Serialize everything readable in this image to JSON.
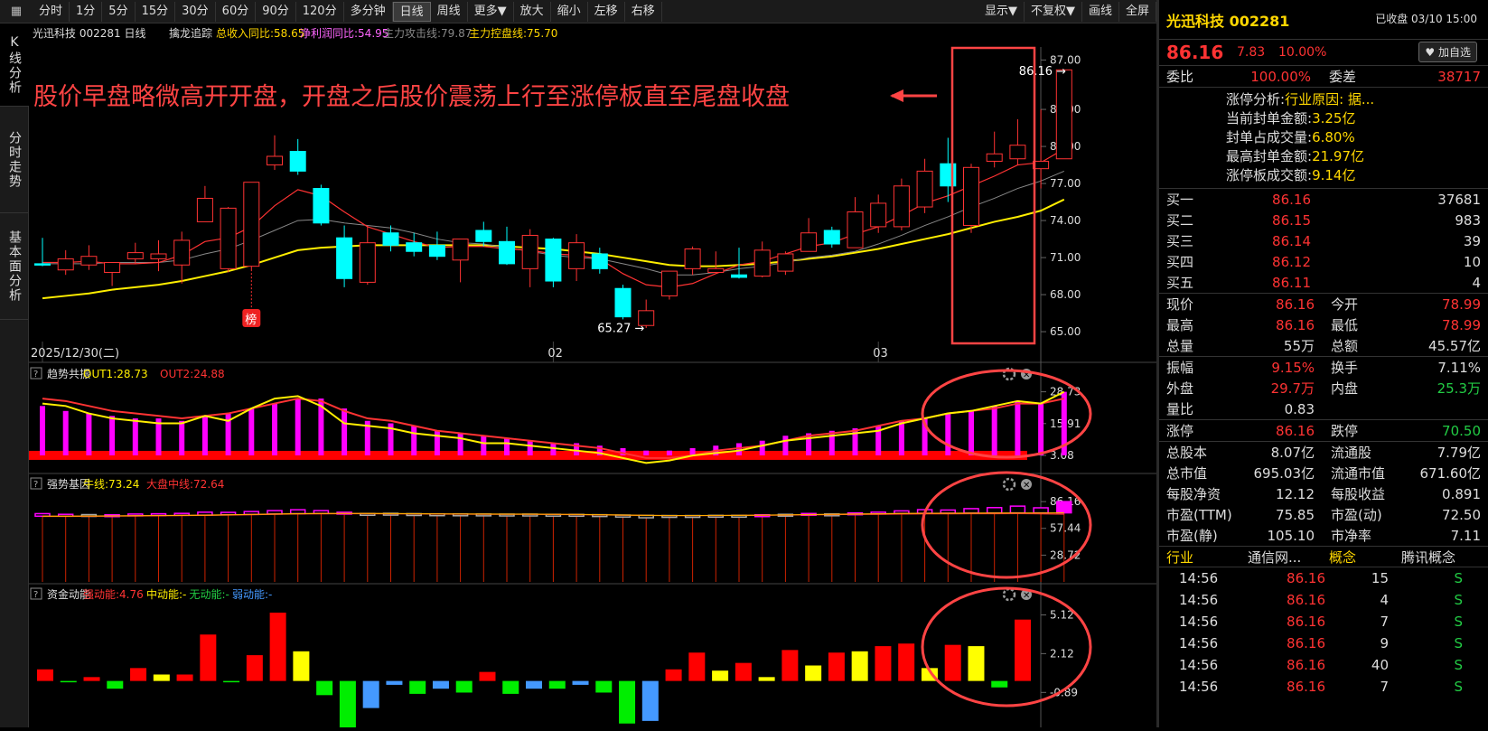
{
  "toolbar": {
    "periods": [
      "分时",
      "1分",
      "5分",
      "15分",
      "30分",
      "60分",
      "90分",
      "120分",
      "多分钟",
      "日线",
      "周线",
      "更多▼"
    ],
    "actions": [
      "放大",
      "缩小",
      "左移",
      "右移"
    ],
    "right_items": [
      "显示▼",
      "不复权▼",
      "画线",
      "全屏"
    ]
  },
  "left_tabs": [
    "K线分析",
    "分时走势",
    "基本面分析"
  ],
  "main_info": {
    "stock": "光迅科技 002281 日线",
    "indicator": "擒龙追踪",
    "rev_label": "总收入同比:58.65",
    "profit_label": "净利润同比:54.95",
    "attack_label": "主力攻击线:79.87",
    "control_label": "主力控盘线:75.70"
  },
  "annotation": "股价早盘略微高开开盘，开盘之后股价震荡上行至涨停板直至尾盘收盘",
  "chart_data": [
    {
      "type": "candlestick",
      "title": "光迅科技 002281 日线",
      "y_ticks": [
        "87.00",
        "83.00",
        "80.00",
        "77.00",
        "74.00",
        "71.00",
        "68.00",
        "65.00"
      ],
      "ylim": [
        64.2,
        88.2
      ],
      "x_labels": [
        {
          "i": 0,
          "label": "2025/12/30(二)"
        },
        {
          "i": 22,
          "label": "02"
        },
        {
          "i": 36,
          "label": "03"
        }
      ],
      "max_label": "86.16",
      "min_label": "65.27",
      "marker_label": "榜",
      "candles": [
        [
          70.5,
          70.4,
          72.6,
          70.3
        ],
        [
          70.0,
          70.9,
          71.6,
          69.6
        ],
        [
          70.4,
          71.1,
          72.0,
          70.0
        ],
        [
          69.8,
          70.6,
          70.6,
          68.7
        ],
        [
          70.9,
          71.4,
          72.2,
          70.5
        ],
        [
          70.9,
          71.3,
          72.4,
          69.9
        ],
        [
          70.4,
          72.4,
          73.1,
          68.9
        ],
        [
          73.9,
          75.8,
          76.8,
          73.9
        ],
        [
          70.1,
          75.0,
          75.1,
          69.8
        ],
        [
          70.3,
          77.1,
          77.1,
          69.9
        ],
        [
          78.5,
          79.2,
          80.9,
          78.1
        ],
        [
          79.6,
          78.0,
          80.6,
          77.7
        ],
        [
          76.6,
          73.8,
          76.9,
          73.6
        ],
        [
          72.6,
          69.3,
          73.6,
          68.6
        ],
        [
          69.0,
          72.2,
          73.6,
          68.8
        ],
        [
          73.0,
          72.0,
          73.6,
          71.5
        ],
        [
          72.2,
          71.5,
          73.0,
          71.1
        ],
        [
          72.0,
          71.1,
          73.1,
          70.8
        ],
        [
          70.8,
          72.5,
          72.5,
          69.0
        ],
        [
          73.2,
          72.3,
          73.9,
          71.9
        ],
        [
          72.3,
          70.5,
          73.5,
          70.4
        ],
        [
          70.1,
          72.8,
          73.3,
          68.6
        ],
        [
          72.5,
          69.1,
          72.6,
          68.6
        ],
        [
          70.1,
          72.2,
          72.9,
          69.1
        ],
        [
          71.3,
          70.1,
          71.8,
          69.7
        ],
        [
          68.5,
          66.2,
          68.8,
          66.0
        ],
        [
          65.5,
          66.7,
          67.6,
          65.3
        ],
        [
          67.9,
          69.9,
          69.9,
          67.6
        ],
        [
          70.1,
          71.7,
          71.9,
          69.6
        ],
        [
          69.8,
          70.1,
          71.5,
          69.8
        ],
        [
          69.6,
          69.4,
          71.8,
          69.3
        ],
        [
          69.5,
          71.6,
          72.3,
          69.4
        ],
        [
          69.9,
          71.3,
          71.5,
          69.6
        ],
        [
          71.5,
          73.0,
          74.2,
          71.5
        ],
        [
          73.2,
          72.1,
          73.5,
          71.8
        ],
        [
          71.8,
          74.7,
          75.9,
          71.8
        ],
        [
          73.5,
          75.4,
          76.1,
          73.0
        ],
        [
          73.5,
          76.8,
          77.4,
          73.2
        ],
        [
          75.1,
          78.0,
          79.0,
          74.6
        ],
        [
          78.6,
          76.8,
          80.7,
          75.5
        ],
        [
          73.6,
          78.3,
          78.6,
          73.0
        ],
        [
          78.8,
          79.4,
          81.2,
          78.3
        ],
        [
          79.0,
          80.1,
          82.2,
          78.5
        ],
        [
          78.2,
          78.8,
          83.0,
          76.6
        ],
        [
          79.0,
          86.2,
          86.2,
          79.0
        ]
      ],
      "ma_red": [
        70.6,
        70.6,
        70.7,
        70.5,
        70.5,
        70.6,
        71.2,
        72.3,
        72.6,
        73.5,
        75.2,
        76.5,
        76.0,
        74.7,
        73.5,
        72.9,
        72.3,
        71.8,
        71.9,
        71.9,
        71.7,
        71.6,
        71.3,
        71.2,
        70.9,
        69.7,
        68.8,
        68.6,
        68.9,
        69.7,
        70.4,
        70.7,
        71.3,
        71.9,
        72.2,
        72.9,
        73.5,
        74.4,
        75.4,
        76.0,
        76.8,
        77.6,
        78.5,
        78.7,
        79.8
      ],
      "ma_gray": [
        70.5,
        70.5,
        70.5,
        70.6,
        70.6,
        70.6,
        70.8,
        71.3,
        71.7,
        72.4,
        73.2,
        74.0,
        74.1,
        73.8,
        73.6,
        73.4,
        73.0,
        72.5,
        72.2,
        72.1,
        71.8,
        71.5,
        71.2,
        71.0,
        70.9,
        70.5,
        70.1,
        69.6,
        69.6,
        69.8,
        70.1,
        70.3,
        70.6,
        71.0,
        71.2,
        71.5,
        72.1,
        72.8,
        73.6,
        74.3,
        75.1,
        75.8,
        76.6,
        77.2,
        78.0
      ],
      "ma_yellow": [
        67.7,
        67.9,
        68.1,
        68.4,
        68.6,
        68.8,
        69.1,
        69.5,
        69.9,
        70.4,
        71.0,
        71.6,
        71.8,
        71.9,
        72.0,
        72.0,
        72.0,
        72.0,
        72.0,
        72.0,
        71.9,
        71.8,
        71.7,
        71.5,
        71.3,
        71.0,
        70.7,
        70.4,
        70.3,
        70.3,
        70.4,
        70.5,
        70.7,
        70.9,
        71.1,
        71.4,
        71.7,
        72.1,
        72.5,
        72.9,
        73.4,
        73.9,
        74.3,
        74.8,
        75.7
      ]
    },
    {
      "type": "bar",
      "title": "趋势共振",
      "out1_label": "OUT1:28.73",
      "out2_label": "OUT2:24.88",
      "y_ticks": [
        "28.73",
        "15.91",
        "3.08"
      ],
      "ylim": [
        -3.5,
        31.5
      ],
      "baseline": 3.08,
      "values": [
        23,
        21,
        20,
        19,
        18,
        18,
        17,
        19,
        20,
        22,
        24,
        26,
        26,
        22,
        17,
        16,
        15,
        13,
        12,
        11,
        10,
        9,
        8,
        8,
        7,
        6,
        5,
        5,
        6,
        7,
        8,
        9,
        11,
        12,
        13,
        14,
        15,
        17,
        18,
        20,
        21,
        23,
        25,
        24,
        28.73
      ],
      "out1_line": [
        24,
        23,
        20,
        18,
        17,
        16,
        16,
        19,
        17,
        22,
        26,
        27,
        23,
        16,
        15,
        14,
        12,
        11,
        10,
        8,
        8,
        7,
        6,
        5,
        4,
        2,
        0,
        1,
        3,
        4,
        5,
        7,
        9,
        10,
        11,
        12,
        13,
        16,
        18,
        20,
        21,
        23,
        25,
        24,
        28.73
      ],
      "out2_line": [
        26,
        25,
        23,
        21,
        20,
        19,
        18,
        19,
        20,
        22,
        24,
        26,
        25,
        21,
        18,
        17,
        15,
        13,
        12,
        11,
        10,
        9,
        8,
        7,
        6,
        4,
        2,
        2,
        3,
        5,
        6,
        7,
        9,
        11,
        12,
        13,
        15,
        17,
        18,
        20,
        21,
        22,
        24,
        24,
        26
      ]
    },
    {
      "type": "bar",
      "title": "强势基因",
      "bull_label": "牛线:73.24",
      "market_label": "大盘中线:72.64",
      "y_ticks": [
        "86.16",
        "57.44",
        "28.72"
      ],
      "ylim": [
        0,
        95
      ],
      "values": [
        73.24,
        72.5,
        72.2,
        72.0,
        72.8,
        73.1,
        73.5,
        74.8,
        74.6,
        75.5,
        76.5,
        77.4,
        76.5,
        74.7,
        73.2,
        73.6,
        72.8,
        72.3,
        72.6,
        72.8,
        72.1,
        72.7,
        71.6,
        72.3,
        71.0,
        69.6,
        68.8,
        69.8,
        71.1,
        71.4,
        71.2,
        72.0,
        72.5,
        73.4,
        72.9,
        74.0,
        74.8,
        76.2,
        77.5,
        77.1,
        78.6,
        79.7,
        81.3,
        79.5,
        86.16
      ],
      "colors": [
        "m",
        "m",
        "w",
        "m",
        "m",
        "m",
        "m",
        "m",
        "m",
        "m",
        "m",
        "m",
        "m",
        "m",
        "w",
        "w",
        "w",
        "w",
        "w",
        "w",
        "w",
        "w",
        "w",
        "w",
        "w",
        "w",
        "w",
        "w",
        "w",
        "w",
        "w",
        "m",
        "w",
        "m",
        "w",
        "m",
        "m",
        "m",
        "m",
        "m",
        "m",
        "m",
        "m",
        "m",
        "m"
      ],
      "bull_line": [
        70.5,
        70.5,
        70.7,
        70.8,
        71.0,
        71.2,
        71.4,
        71.6,
        72.0,
        72.4,
        72.8,
        73.2,
        73.4,
        73.5,
        73.4,
        73.3,
        73.2,
        73.0,
        72.9,
        72.8,
        72.7,
        72.7,
        72.5,
        72.4,
        72.1,
        71.7,
        71.4,
        71.2,
        71.2,
        71.3,
        71.4,
        71.6,
        71.9,
        72.2,
        72.5,
        72.8,
        73.1,
        73.4,
        73.6,
        73.7,
        73.8,
        73.9,
        74.0,
        74.0,
        74.1
      ],
      "market_line": [
        70.2,
        70.3,
        70.4,
        70.6,
        70.8,
        71.0,
        71.2,
        71.4,
        71.7,
        72.1,
        72.5,
        72.9,
        73.1,
        73.2,
        73.2,
        73.1,
        73.0,
        72.8,
        72.7,
        72.6,
        72.5,
        72.5,
        72.3,
        72.2,
        71.9,
        71.6,
        71.3,
        71.2,
        71.2,
        71.2,
        71.3,
        71.5,
        71.7,
        72.0,
        72.2,
        72.4,
        72.6,
        72.8,
        73.0,
        73.1,
        73.2,
        73.2,
        73.3,
        73.1,
        72.64
      ]
    },
    {
      "type": "bar",
      "title": "资金动能",
      "strong_label": "强动能:4.76",
      "mid_label": "中动能:-",
      "none_label": "无动能:-",
      "weak_label": "弱动能:-",
      "y_ticks": [
        "5.12",
        "2.12",
        "-0.89"
      ],
      "ylim": [
        -3.6,
        6.0
      ],
      "values": [
        0.9,
        -0.1,
        0.3,
        -0.6,
        1.0,
        0.5,
        0.5,
        3.6,
        -0.1,
        2.0,
        5.3,
        2.3,
        -1.1,
        -3.6,
        -2.1,
        -0.3,
        -1.0,
        -0.6,
        -0.9,
        0.7,
        -1.0,
        -0.6,
        -0.6,
        -0.3,
        -0.9,
        -3.3,
        -3.1,
        0.9,
        2.2,
        0.8,
        1.4,
        0.3,
        2.4,
        1.2,
        2.2,
        2.3,
        2.7,
        2.9,
        1.0,
        2.8,
        2.7,
        -0.5,
        4.76
      ],
      "colors": [
        "r",
        "g",
        "r",
        "g",
        "r",
        "y",
        "r",
        "r",
        "g",
        "r",
        "r",
        "y",
        "g",
        "g",
        "b",
        "b",
        "g",
        "b",
        "g",
        "r",
        "g",
        "b",
        "g",
        "b",
        "g",
        "g",
        "b",
        "r",
        "r",
        "y",
        "r",
        "y",
        "r",
        "y",
        "r",
        "y",
        "r",
        "r",
        "y",
        "r",
        "y",
        "g",
        "r"
      ]
    }
  ],
  "quote": {
    "name": "光迅科技",
    "code": "002281",
    "status": "已收盘 03/10 15:00",
    "price": "86.16",
    "change": "7.83",
    "pct": "10.00%",
    "watch_btn": "♥ 加自选",
    "wb_label": "委比",
    "wb_val": "100.00%",
    "wc_label": "委差",
    "wc_val": "38717",
    "zt": [
      {
        "k": "涨停分析:",
        "v": "行业原因: 据..."
      },
      {
        "k": "当前封单金额:",
        "v": "3.25亿"
      },
      {
        "k": "封单占成交量:",
        "v": "6.80%"
      },
      {
        "k": "最高封单金额:",
        "v": "21.97亿"
      },
      {
        "k": "涨停板成交额:",
        "v": "9.14亿"
      }
    ],
    "book": [
      {
        "label": "买一",
        "price": "86.16",
        "vol": "37681"
      },
      {
        "label": "买二",
        "price": "86.15",
        "vol": "983"
      },
      {
        "label": "买三",
        "price": "86.14",
        "vol": "39"
      },
      {
        "label": "买四",
        "price": "86.12",
        "vol": "10"
      },
      {
        "label": "买五",
        "price": "86.11",
        "vol": "4"
      }
    ],
    "stats1": [
      {
        "l1": "现价",
        "v1": "86.16",
        "c1": "red",
        "l2": "今开",
        "v2": "78.99",
        "c2": "red"
      },
      {
        "l1": "最高",
        "v1": "86.16",
        "c1": "red",
        "l2": "最低",
        "v2": "78.99",
        "c2": "red"
      },
      {
        "l1": "总量",
        "v1": "55万",
        "c1": "white",
        "l2": "总额",
        "v2": "45.57亿",
        "c2": "white"
      }
    ],
    "stats2": [
      {
        "l1": "振幅",
        "v1": "9.15%",
        "c1": "red",
        "l2": "换手",
        "v2": "7.11%",
        "c2": "white"
      },
      {
        "l1": "外盘",
        "v1": "29.7万",
        "c1": "red",
        "l2": "内盘",
        "v2": "25.3万",
        "c2": "green"
      },
      {
        "l1": "量比",
        "v1": "0.83",
        "c1": "white",
        "l2": "",
        "v2": "",
        "c2": "white"
      }
    ],
    "stats3": [
      {
        "l1": "涨停",
        "v1": "86.16",
        "c1": "red",
        "l2": "跌停",
        "v2": "70.50",
        "c2": "green"
      }
    ],
    "stats4": [
      {
        "l1": "总股本",
        "v1": "8.07亿",
        "c1": "white",
        "l2": "流通股",
        "v2": "7.79亿",
        "c2": "white"
      },
      {
        "l1": "总市值",
        "v1": "695.03亿",
        "c1": "white",
        "l2": "流通市值",
        "v2": "671.60亿",
        "c2": "white"
      },
      {
        "l1": "每股净资",
        "v1": "12.12",
        "c1": "white",
        "l2": "每股收益",
        "v2": "0.891",
        "c2": "white"
      },
      {
        "l1": "市盈(TTM)",
        "v1": "75.85",
        "c1": "white",
        "l2": "市盈(动)",
        "v2": "72.50",
        "c2": "white"
      },
      {
        "l1": "市盈(静)",
        "v1": "105.10",
        "c1": "white",
        "l2": "市净率",
        "v2": "7.11",
        "c2": "white"
      }
    ],
    "industry": {
      "l1": "行业",
      "v1": "通信网...",
      "l2": "概念",
      "v2": "腾讯概念"
    },
    "ticks": [
      {
        "t": "14:56",
        "p": "86.16",
        "v": "15",
        "s": "S"
      },
      {
        "t": "14:56",
        "p": "86.16",
        "v": "4",
        "s": "S"
      },
      {
        "t": "14:56",
        "p": "86.16",
        "v": "7",
        "s": "S"
      },
      {
        "t": "14:56",
        "p": "86.16",
        "v": "9",
        "s": "S"
      },
      {
        "t": "14:56",
        "p": "86.16",
        "v": "40",
        "s": "S"
      },
      {
        "t": "14:56",
        "p": "86.16",
        "v": "7",
        "s": "S"
      }
    ]
  }
}
